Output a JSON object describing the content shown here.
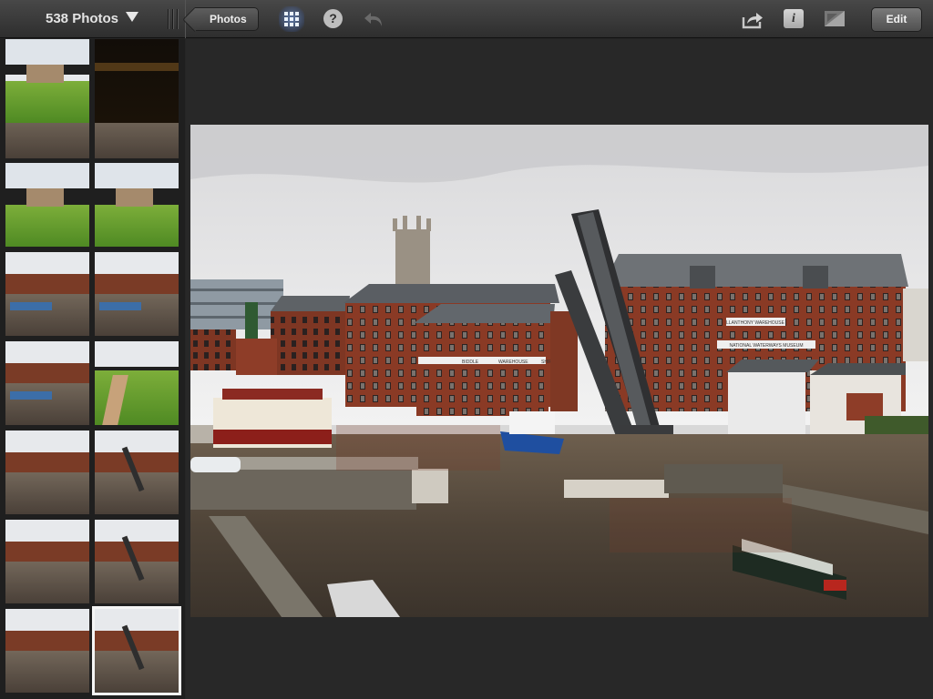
{
  "toolbar": {
    "album_title": "538 Photos",
    "back_label": "Photos",
    "help_glyph": "?",
    "info_glyph": "i",
    "edit_label": "Edit",
    "accent": "#7aa6ff"
  },
  "icons": {
    "album_menu": "chevron-down-icon",
    "grip": "grip-icon",
    "grid": "grid-view-icon",
    "help": "help-icon",
    "undo": "undo-icon",
    "share": "share-icon",
    "info": "info-icon",
    "compare": "compare-icon"
  },
  "thumbnails": [
    {
      "scene": "canal"
    },
    {
      "scene": "canal"
    },
    {
      "scene": "field"
    },
    {
      "scene": "field"
    },
    {
      "scene": "dock"
    },
    {
      "scene": "dock"
    },
    {
      "scene": "dock"
    },
    {
      "scene": "path"
    },
    {
      "scene": "canal"
    },
    {
      "scene": "bridge"
    },
    {
      "scene": "canal"
    },
    {
      "scene": "bridge"
    },
    {
      "scene": "canal"
    },
    {
      "scene": "bridge",
      "selected": true
    },
    {
      "scene": "field"
    },
    {
      "scene": "night"
    }
  ],
  "photo": {
    "warehouse_sign_1": "LLANTHONY WAREHOUSE",
    "warehouse_sign_2": "NATIONAL WATERWAYS MUSEUM",
    "warehouse_band": [
      "BIDDLE",
      "WAREHOUSE",
      "SHIPTON"
    ]
  }
}
